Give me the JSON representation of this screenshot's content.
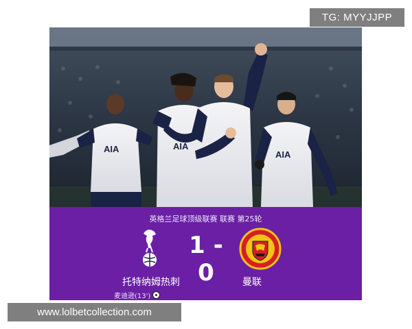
{
  "watermark_tg": "TG: MYYJJPP",
  "watermark_url": "www.lolbetcollection.com",
  "photo": {
    "shirt_sponsor": "AIA",
    "description_icon": "celebrating-players-photo"
  },
  "match": {
    "league": "英格兰足球顶级联赛 联赛 第25轮",
    "home_score": "1",
    "separator": "-",
    "away_score": "0",
    "home_team": "托特纳姆热刺",
    "away_team": "曼联",
    "scorer": "麦迪逊(13')",
    "scorer_icon": "football-icon"
  },
  "colors": {
    "panel_purple": "#6a1fa4",
    "away_red": "#d61f26",
    "away_gold": "#f3c317",
    "badge_gray": "#7f7f7f"
  }
}
